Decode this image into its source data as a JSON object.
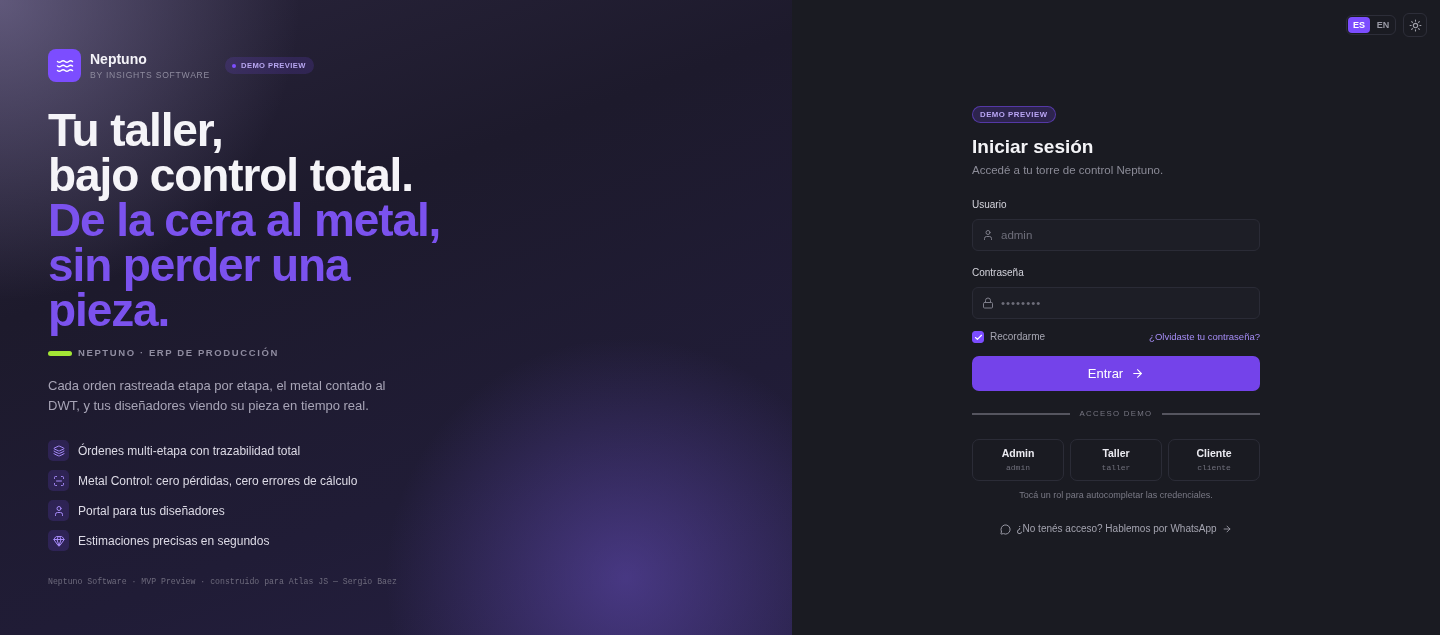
{
  "brand": {
    "name": "Neptuno",
    "tagline": "BY INSIGHTS SOFTWARE",
    "badge": "DEMO PREVIEW"
  },
  "hero": {
    "headline": [
      "Tu taller,",
      "bajo control total."
    ],
    "accent": [
      "De la cera al metal,",
      "sin perder una",
      "pieza."
    ],
    "eyebrow": "NEPTUNO · ERP DE PRODUCCIÓN",
    "description": "Cada orden rastreada etapa por etapa, el metal contado al DWT, y tus diseñadores viendo su pieza en tiempo real.",
    "features": [
      {
        "kind": "layers",
        "text": "Órdenes multi-etapa con trazabilidad total"
      },
      {
        "kind": "scan",
        "text": "Metal Control: cero pérdidas, cero errores de cálculo"
      },
      {
        "kind": "user",
        "text": "Portal para tus diseñadores"
      },
      {
        "kind": "gem",
        "text": "Estimaciones precisas en segundos"
      }
    ],
    "footer": "Neptuno Software · MVP Preview · construido para Atlas JS — Sergio Baez"
  },
  "language_switch": [
    {
      "label": "ES",
      "selected": true
    },
    {
      "label": "EN",
      "selected": false
    }
  ],
  "login": {
    "badge": "DEMO PREVIEW",
    "title": "Iniciar sesión",
    "subtitle": "Accedé a tu torre de control Neptuno.",
    "fields": [
      {
        "kind": "user",
        "label": "Usuario",
        "placeholder": "admin"
      },
      {
        "kind": "password",
        "label": "Contraseña",
        "placeholder": "••••••••"
      }
    ],
    "remember": {
      "label": "Recordarme",
      "checked": true
    },
    "forgot_link": "¿Olvidaste tu contraseña?",
    "submit": "Entrar",
    "divider": "ACCESO DEMO",
    "demo_roles": [
      {
        "name": "Admin",
        "username": "admin"
      },
      {
        "name": "Taller",
        "username": "taller"
      },
      {
        "name": "Cliente",
        "username": "cliente"
      }
    ],
    "hint": "Tocá un rol para autocompletar las credenciales.",
    "contact_link": "¿No tenés acceso? Hablemos por WhatsApp"
  }
}
